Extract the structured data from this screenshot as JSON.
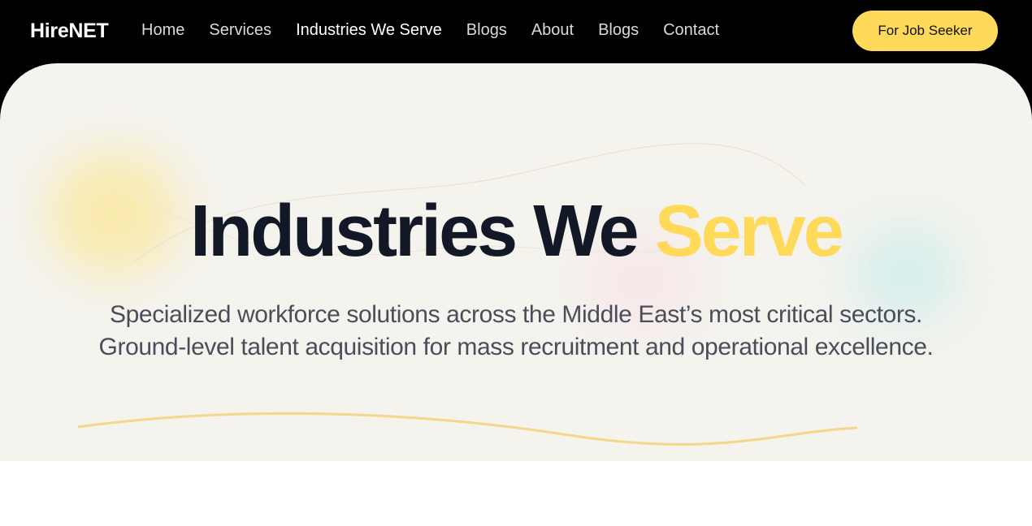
{
  "brand": "HireNET",
  "nav": {
    "items": [
      {
        "label": "Home"
      },
      {
        "label": "Services"
      },
      {
        "label": "Industries We Serve"
      },
      {
        "label": "Blogs"
      },
      {
        "label": "About"
      },
      {
        "label": "Blogs"
      },
      {
        "label": "Contact"
      }
    ],
    "active_index": 2,
    "cta_label": "For Job Seeker"
  },
  "hero": {
    "title_main": "Industries We",
    "title_accent": "Serve",
    "subtitle_line1": "Specialized workforce solutions across the Middle East’s most critical sectors.",
    "subtitle_line2": "Ground-level talent acquisition for mass recruitment and operational excellence."
  },
  "colors": {
    "accent": "#ffd95a",
    "nav_background": "#000000",
    "hero_background": "#f4f3ee",
    "title_text": "#131826"
  }
}
